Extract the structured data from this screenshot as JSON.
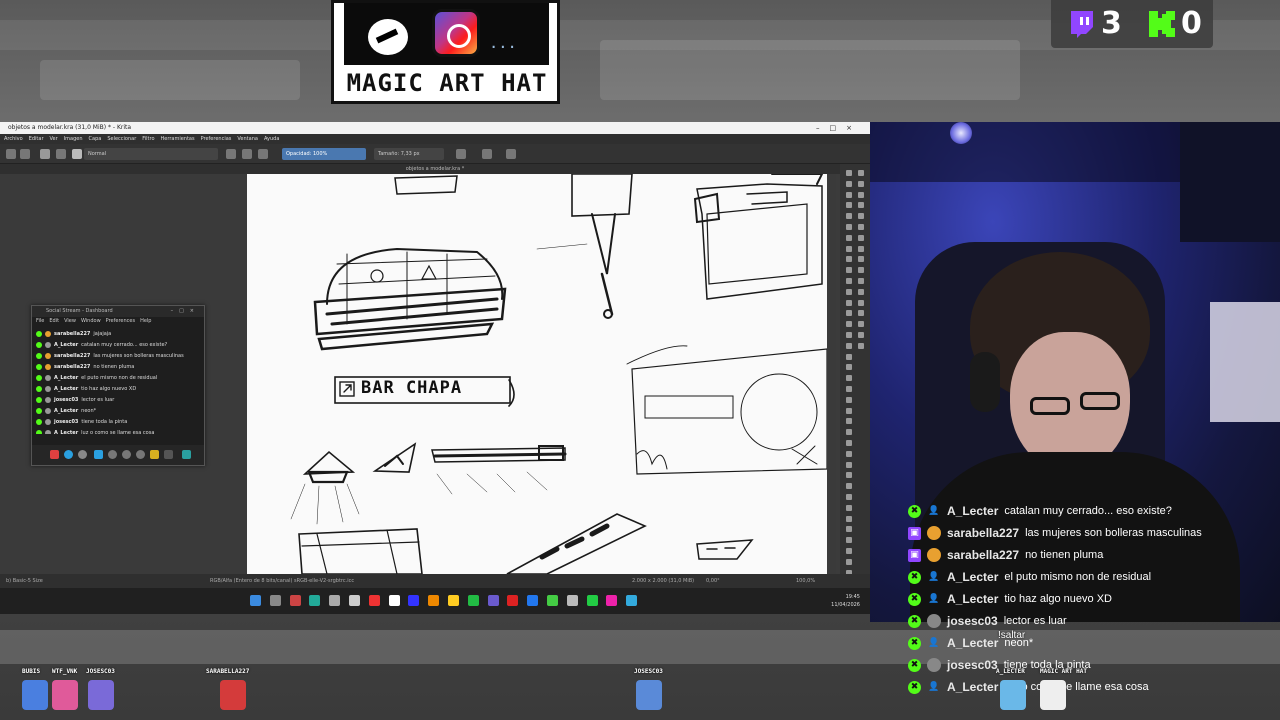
{
  "overlay": {
    "logo_title": "MAGIC ART HAT",
    "logo_dots": "...",
    "counters": {
      "twitch_count": "3",
      "kick_count": "0",
      "twitch_color": "#9146ff",
      "kick_color": "#53fc18"
    }
  },
  "krita": {
    "window_title": "objetos a modelar.kra (31,0 MiB) * - Krita",
    "menu": [
      "Archivo",
      "Editar",
      "Ver",
      "Imagen",
      "Capa",
      "Seleccionar",
      "Filtro",
      "Herramientas",
      "Preferencias",
      "Ventana",
      "Ayuda"
    ],
    "blend_mode": "Normal",
    "opacity": "Opacidad: 100%",
    "size": "Tamaño: 7,33 px",
    "doc_tab": "objetos a modelar.kra *",
    "canvas_text": "BAR CHAPA",
    "status_left": "b) Basic-5 Size",
    "status_center": "RGB/Alfa (Entero de 8 bits/canal)  sRGB-elle-V2-srgbtrc.icc",
    "status_right": "2.000 x 2.000 (31,0 MiB)",
    "rotation": "0,00°",
    "zoom": "100,0%",
    "clock_time": "19:45",
    "clock_date": "11/04/2026"
  },
  "social_stream": {
    "title": "Social Stream - Dashboard",
    "menu": [
      "File",
      "Edit",
      "View",
      "Window",
      "Preferences",
      "Help"
    ],
    "rows": [
      {
        "user": "sarabella227",
        "msg": "jajajaja",
        "platform": "twitch"
      },
      {
        "user": "A_Lecter",
        "msg": "catalan muy cerrado... eso existe?",
        "platform": "kick"
      },
      {
        "user": "sarabella227",
        "msg": "las mujeres son bolleras masculinas",
        "platform": "twitch"
      },
      {
        "user": "sarabella227",
        "msg": "no tienen pluma",
        "platform": "twitch"
      },
      {
        "user": "A_Lecter",
        "msg": "el puto mismo non de residual",
        "platform": "kick"
      },
      {
        "user": "A_Lecter",
        "msg": "tio haz algo nuevo XD",
        "platform": "kick"
      },
      {
        "user": "josesc03",
        "msg": "lector es luar",
        "platform": "kick"
      },
      {
        "user": "A_Lecter",
        "msg": "neon*",
        "platform": "kick"
      },
      {
        "user": "josesc03",
        "msg": "tiene toda la pinta",
        "platform": "kick"
      },
      {
        "user": "A_Lecter",
        "msg": "luz o como se llame esa cosa",
        "platform": "kick"
      }
    ]
  },
  "chat": [
    {
      "user": "A_Lecter",
      "msg": "catalan muy cerrado... eso existe?",
      "platform": "kick"
    },
    {
      "user": "sarabella227",
      "msg": "las mujeres son bolleras masculinas",
      "platform": "twitch"
    },
    {
      "user": "sarabella227",
      "msg": "no tienen pluma",
      "platform": "twitch"
    },
    {
      "user": "A_Lecter",
      "msg": "el puto mismo non de residual",
      "platform": "kick"
    },
    {
      "user": "A_Lecter",
      "msg": "tio haz algo nuevo XD",
      "platform": "kick"
    },
    {
      "user": "josesc03",
      "msg": "lector es luar",
      "platform": "kick"
    },
    {
      "user": "A_Lecter",
      "msg": "neon*",
      "platform": "kick"
    },
    {
      "user": "josesc03",
      "msg": "tiene toda la pinta",
      "platform": "kick"
    },
    {
      "user": "A_Lecter",
      "msg": "luz o como se llame esa cosa",
      "platform": "kick"
    }
  ],
  "chat_popup": "!saltar",
  "avatars": [
    {
      "name": "BUBIS",
      "color": "#4a7fe0"
    },
    {
      "name": "WTF_VNK",
      "color": "#e05a9a"
    },
    {
      "name": "JOSESC03",
      "color": "#7a6ad8"
    },
    {
      "name": "SARABELLA227",
      "color": "#d43b3b"
    },
    {
      "name": "JOSESC03",
      "color": "#5a8ad8"
    },
    {
      "name": "A_LECTER",
      "color": "#6ab8e8"
    },
    {
      "name": "MAGIC ART HAT",
      "color": "#eeeeee"
    }
  ]
}
